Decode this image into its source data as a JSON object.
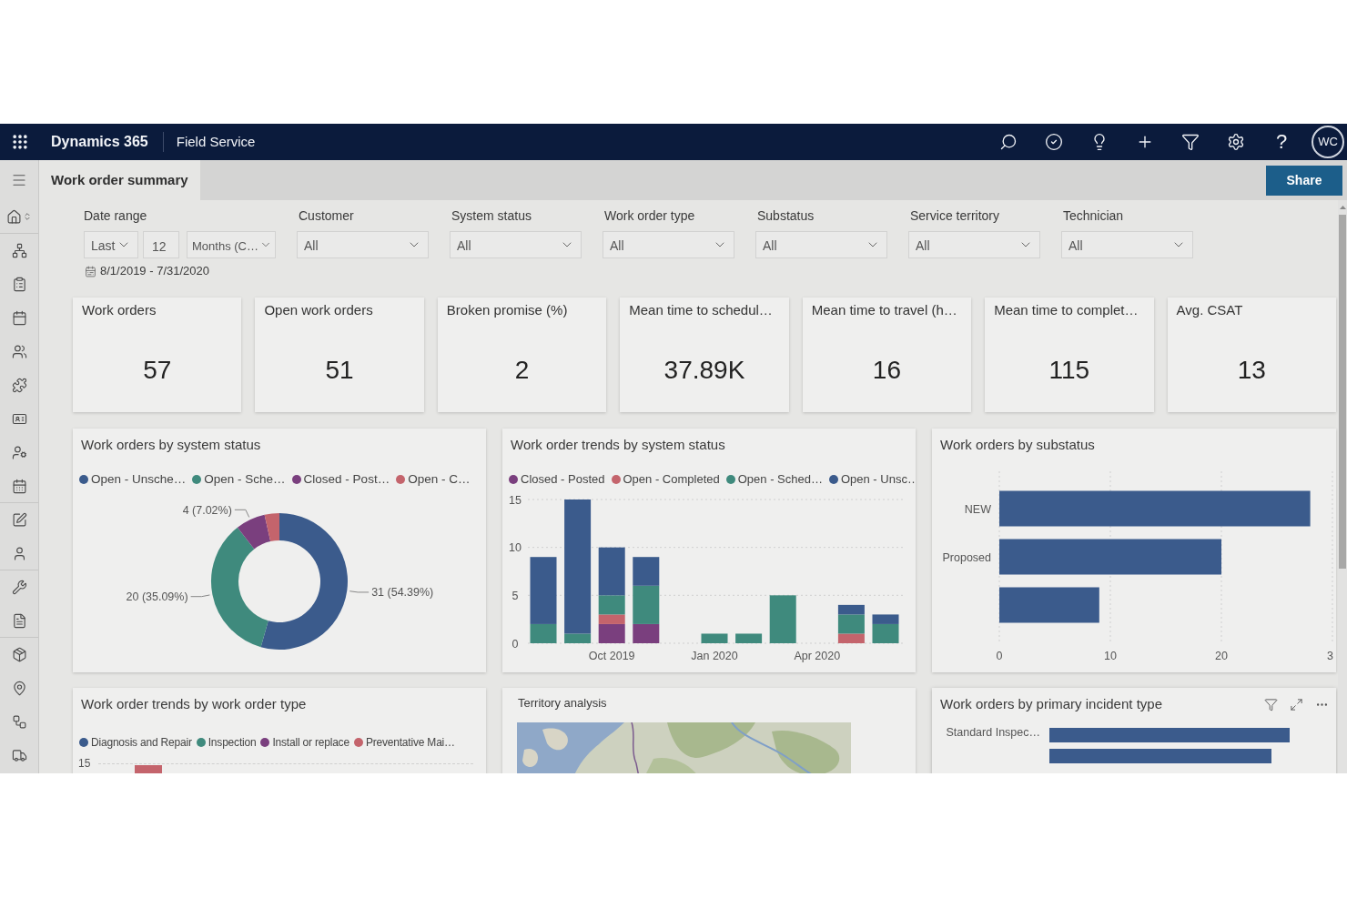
{
  "top_bar": {
    "app_name": "Dynamics 365",
    "module": "Field Service",
    "help": "?",
    "avatar": "WC"
  },
  "page_tab": {
    "label": "Work order summary",
    "selected": true
  },
  "share_button": "Share",
  "date_range": {
    "label": "Date range",
    "period": "Last",
    "count": "12",
    "unit": "Months (C…",
    "dates": "8/1/2019 - 7/31/2020"
  },
  "filters": [
    {
      "label": "Customer",
      "value": "All"
    },
    {
      "label": "System status",
      "value": "All"
    },
    {
      "label": "Work order type",
      "value": "All"
    },
    {
      "label": "Substatus",
      "value": "All"
    },
    {
      "label": "Service territory",
      "value": "All"
    },
    {
      "label": "Technician",
      "value": "All"
    }
  ],
  "kpis": [
    {
      "title": "Work orders",
      "value": "57"
    },
    {
      "title": "Open work orders",
      "value": "51"
    },
    {
      "title": "Broken promise (%)",
      "value": "2"
    },
    {
      "title": "Mean time to schedul…",
      "value": "37.89K"
    },
    {
      "title": "Mean time to travel (h…",
      "value": "16"
    },
    {
      "title": "Mean time to complet…",
      "value": "115"
    },
    {
      "title": "Avg. CSAT",
      "value": "13"
    }
  ],
  "panels": [
    {
      "kind": "chart",
      "title": "Work orders by system status",
      "focused": false,
      "chart_data": {
        "type": "donut",
        "legend": "top",
        "categories": [
          "Open - Unsche…",
          "Open - Sche…",
          "Closed - Post…",
          "Open - C…"
        ],
        "values": [
          31,
          20,
          4,
          2
        ],
        "colors": [
          "#3b5b8c",
          "#3f8a7d",
          "#7a3f7e",
          "#c4646c"
        ],
        "value_labels": [
          "31 (54.39%)",
          "20 (35.09%)",
          "4 (7.02%)",
          null
        ]
      }
    },
    {
      "kind": "chart",
      "title": "Work order trends by system status",
      "focused": false,
      "chart_data": {
        "type": "bar",
        "stacked": true,
        "legend": "top",
        "categories": [
          null,
          null,
          "Oct 2019",
          null,
          null,
          "Jan 2020",
          null,
          null,
          "Apr 2020",
          null,
          null
        ],
        "ylim": [
          0,
          15
        ],
        "yticks": [
          0,
          5,
          10,
          15
        ],
        "series": [
          {
            "name": "Closed - Posted",
            "color": "#7a3f7e",
            "values": [
              0,
              0,
              2,
              2,
              0,
              0,
              0,
              0,
              0,
              0,
              0
            ]
          },
          {
            "name": "Open - Completed",
            "color": "#c4646c",
            "values": [
              0,
              0,
              1,
              0,
              0,
              0,
              0,
              0,
              0,
              1,
              0
            ]
          },
          {
            "name": "Open - Sched…",
            "color": "#3f8a7d",
            "values": [
              2,
              1,
              2,
              4,
              0,
              1,
              1,
              5,
              0,
              2,
              2
            ]
          },
          {
            "name": "Open - Unsc…",
            "color": "#3b5b8c",
            "values": [
              7,
              14,
              5,
              3,
              0,
              0,
              0,
              0,
              0,
              1,
              1
            ]
          }
        ]
      }
    },
    {
      "kind": "chart",
      "title": "Work orders by substatus",
      "focused": false,
      "axis_edge_label": "3",
      "chart_data": {
        "type": "bar",
        "orientation": "horizontal",
        "categories": [
          "NEW",
          "Proposed",
          null
        ],
        "values": [
          28,
          20,
          9
        ],
        "color": "#3b5b8c",
        "xlim": [
          0,
          30
        ],
        "xticks": [
          0,
          10,
          20
        ]
      }
    },
    {
      "kind": "column_preview",
      "title": "Work order trends by work order type",
      "focused": false,
      "legend": [
        {
          "name": "Diagnosis and Repair",
          "color": "#3b5b8c"
        },
        {
          "name": "Inspection",
          "color": "#3f8a7d"
        },
        {
          "name": "Install or replace",
          "color": "#7a3f7e"
        },
        {
          "name": "Preventative Mai…",
          "color": "#c4646c"
        }
      ],
      "axis_tick": "15"
    },
    {
      "kind": "map",
      "title": "Territory analysis",
      "focused": false
    },
    {
      "kind": "bar_preview",
      "title": "Work orders by primary incident type",
      "focused": true,
      "category_label": "Standard Inspec…"
    }
  ]
}
